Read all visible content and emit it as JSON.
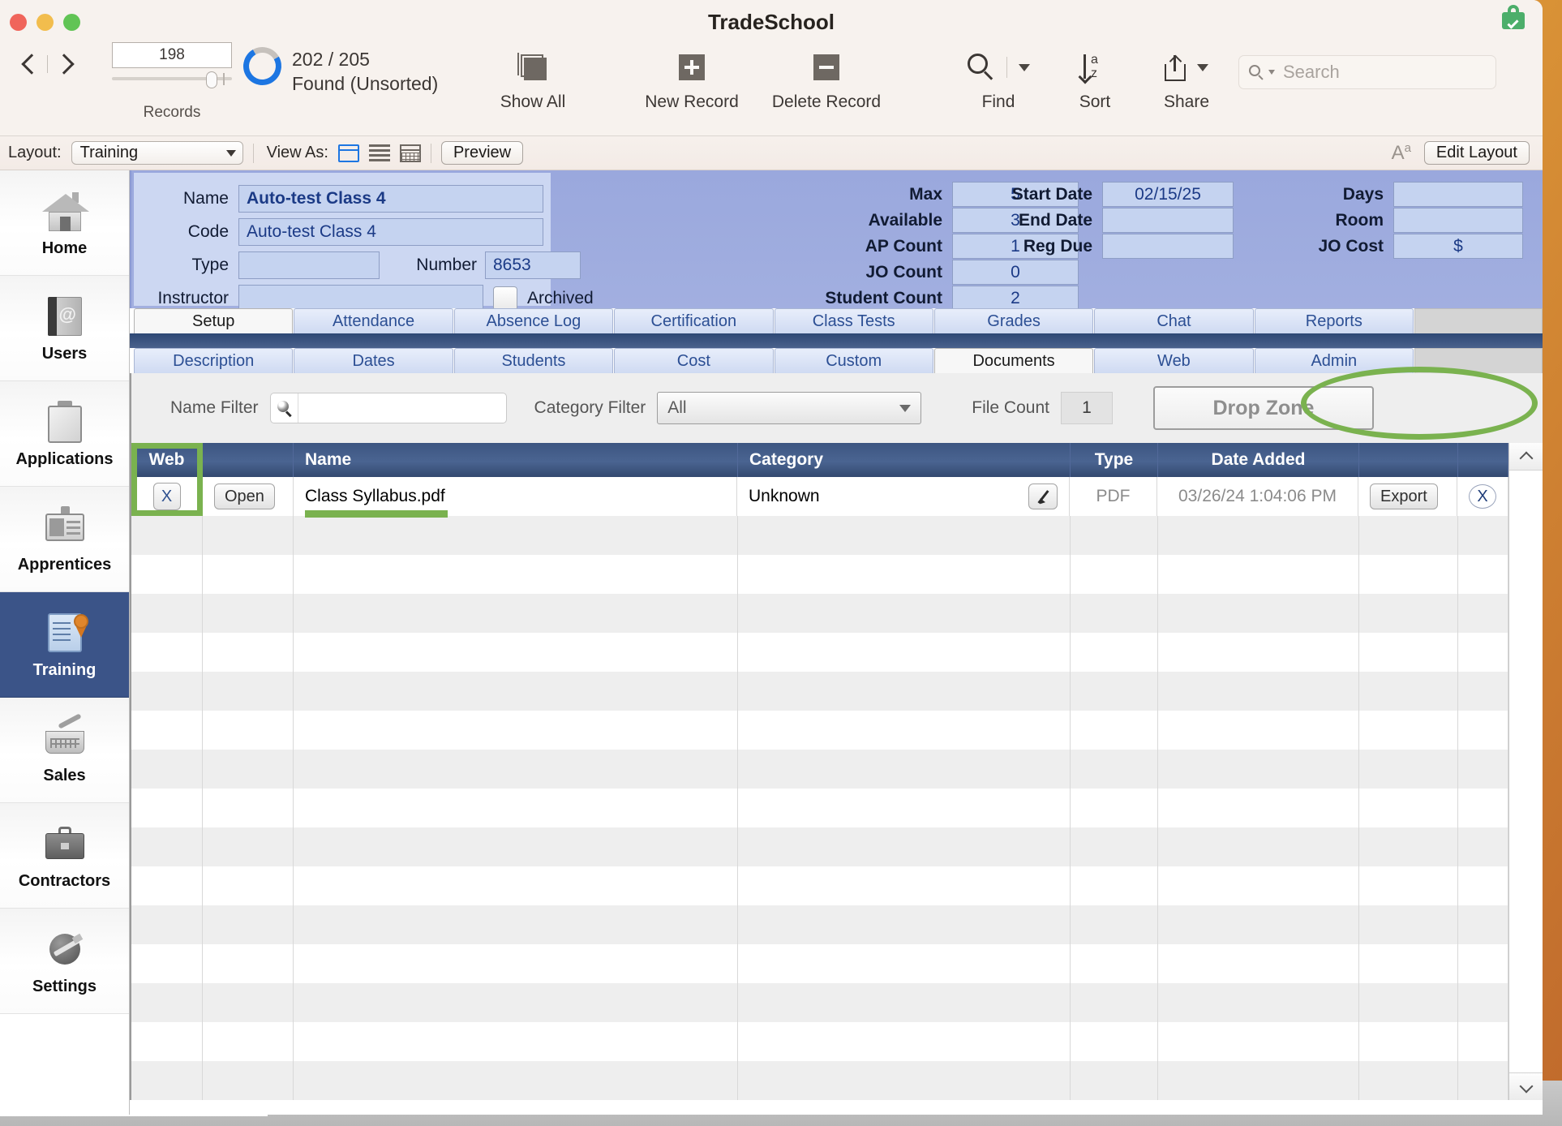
{
  "window": {
    "title": "TradeSchool",
    "lock_badge": "secure-lock-badge"
  },
  "toolbar": {
    "record_number": "198",
    "found_count": "202 / 205",
    "found_status": "Found (Unsorted)",
    "records_label": "Records",
    "items": [
      {
        "label": "Show All",
        "icon": "copy-stack-icon"
      },
      {
        "label": "New Record",
        "icon": "plus-square-icon"
      },
      {
        "label": "Delete Record",
        "icon": "minus-square-icon"
      },
      {
        "label": "Find",
        "icon": "magnifier-icon"
      },
      {
        "label": "Sort",
        "icon": "sort-az-icon"
      },
      {
        "label": "Share",
        "icon": "share-arrow-icon"
      }
    ],
    "search_placeholder": "Search"
  },
  "layout_bar": {
    "layout_label": "Layout:",
    "layout_value": "Training",
    "view_as_label": "View As:",
    "view_modes": [
      "form-view",
      "list-view",
      "table-view"
    ],
    "active_view": "form-view",
    "preview_label": "Preview",
    "text_size_icon": "Aa",
    "edit_layout_label": "Edit Layout"
  },
  "sidebar": {
    "items": [
      {
        "label": "Home",
        "icon": "house-icon",
        "active": false
      },
      {
        "label": "Users",
        "icon": "address-book-icon",
        "active": false
      },
      {
        "label": "Applications",
        "icon": "clipboard-icon",
        "active": false
      },
      {
        "label": "Apprentices",
        "icon": "id-card-icon",
        "active": false
      },
      {
        "label": "Training",
        "icon": "certificate-icon",
        "active": true
      },
      {
        "label": "Sales",
        "icon": "shopping-basket-icon",
        "active": false
      },
      {
        "label": "Contractors",
        "icon": "briefcase-icon",
        "active": false
      },
      {
        "label": "Settings",
        "icon": "globe-hammer-icon",
        "active": false
      }
    ]
  },
  "record_form": {
    "name_label": "Name",
    "name_value": "Auto-test Class 4",
    "code_label": "Code",
    "code_value": "Auto-test Class 4",
    "type_label": "Type",
    "type_value": "",
    "number_label": "Number",
    "number_value": "8653",
    "instructor_label": "Instructor",
    "instructor_value": "",
    "archived_label": "Archived",
    "archived_checked": false,
    "counts": [
      {
        "label": "Max",
        "value": "5"
      },
      {
        "label": "Available",
        "value": "3"
      },
      {
        "label": "AP Count",
        "value": "1"
      },
      {
        "label": "JO Count",
        "value": "0"
      },
      {
        "label": "Student Count",
        "value": "2"
      }
    ],
    "dates": [
      {
        "label": "Start Date",
        "value": "02/15/25"
      },
      {
        "label": "End Date",
        "value": ""
      },
      {
        "label": "Reg Due",
        "value": ""
      }
    ],
    "misc": [
      {
        "label": "Days",
        "value": ""
      },
      {
        "label": "Room",
        "value": ""
      },
      {
        "label": "JO Cost",
        "value": "$"
      }
    ]
  },
  "tabs_primary": {
    "items": [
      "Setup",
      "Attendance",
      "Absence Log",
      "Certification",
      "Class Tests",
      "Grades",
      "Chat",
      "Reports"
    ],
    "active": "Setup"
  },
  "tabs_secondary": {
    "items": [
      "Description",
      "Dates",
      "Students",
      "Cost",
      "Custom",
      "Documents",
      "Web",
      "Admin"
    ],
    "active": "Documents"
  },
  "filters": {
    "name_filter_label": "Name Filter",
    "name_filter_value": "",
    "name_filter_icon": "magnifier-icon",
    "category_filter_label": "Category Filter",
    "category_filter_value": "All",
    "file_count_label": "File Count",
    "file_count_value": "1",
    "drop_zone_label": "Drop Zone"
  },
  "documents_table": {
    "columns": [
      "Web",
      "",
      "Name",
      "Category",
      "",
      "Type",
      "Date Added",
      "",
      ""
    ],
    "headers": {
      "web": "Web",
      "name": "Name",
      "category": "Category",
      "type": "Type",
      "date_added": "Date Added"
    },
    "rows": [
      {
        "web": "X",
        "open_label": "Open",
        "name": "Class Syllabus.pdf",
        "category": "Unknown",
        "edit_icon": "pencil-icon",
        "type": "PDF",
        "date_added": "03/26/24 1:04:06 PM",
        "export_label": "Export",
        "delete_label": "X"
      }
    ],
    "empty_row_count": 15
  },
  "annotations": {
    "highlight_color": "#7ab24f",
    "marks": [
      "drop-zone-oval",
      "web-column-box",
      "name-underline"
    ]
  }
}
